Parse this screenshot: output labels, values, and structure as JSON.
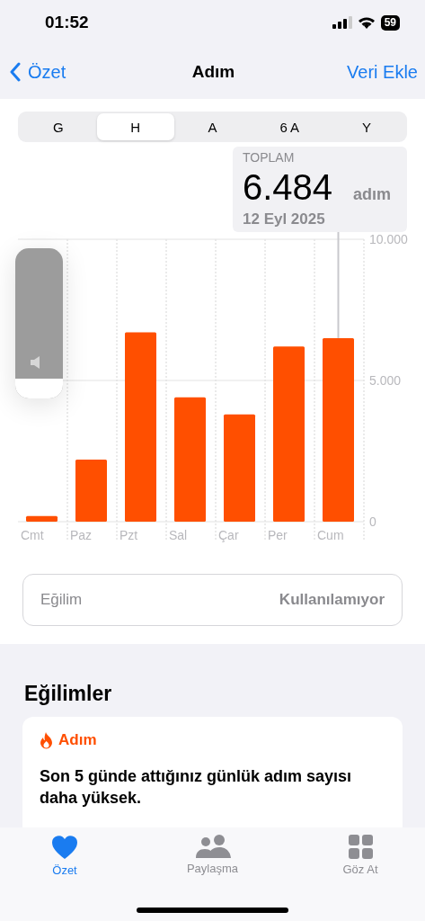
{
  "status_bar": {
    "time": "01:52",
    "battery": "59"
  },
  "nav": {
    "back": "Özet",
    "title": "Adım",
    "action": "Veri Ekle"
  },
  "periods": [
    {
      "label": "G",
      "selected": false
    },
    {
      "label": "H",
      "selected": true
    },
    {
      "label": "A",
      "selected": false
    },
    {
      "label": "6 A",
      "selected": false
    },
    {
      "label": "Y",
      "selected": false
    }
  ],
  "callout": {
    "label": "TOPLAM",
    "value": "6.484",
    "unit": "adım",
    "date": "12 Eyl 2025"
  },
  "chart_data": {
    "type": "bar",
    "categories": [
      "Cmt",
      "Paz",
      "Pzt",
      "Sal",
      "Çar",
      "Per",
      "Cum"
    ],
    "ylim": [
      0,
      10000
    ],
    "yticks": [
      {
        "value": 0,
        "label": "0"
      },
      {
        "value": 5000,
        "label": "5.000"
      },
      {
        "value": 10000,
        "label": "10.000"
      }
    ],
    "values": [
      200,
      2200,
      6700,
      4400,
      3800,
      6200,
      6500
    ]
  },
  "trend_row": {
    "label": "Eğilim",
    "value": "Kullanılamıyor"
  },
  "trends": {
    "title": "Eğilimler",
    "cards": [
      {
        "category": "Adım",
        "text": "Son 5 günde attığınız günlük adım sayısı daha yüksek."
      }
    ]
  },
  "tab_bar": [
    {
      "label": "Özet",
      "kind": "heart",
      "selected": true
    },
    {
      "label": "Paylaşma",
      "kind": "people",
      "selected": false
    },
    {
      "label": "Göz At",
      "kind": "grid",
      "selected": false
    }
  ],
  "volume_hud": {
    "level": 0.13
  }
}
